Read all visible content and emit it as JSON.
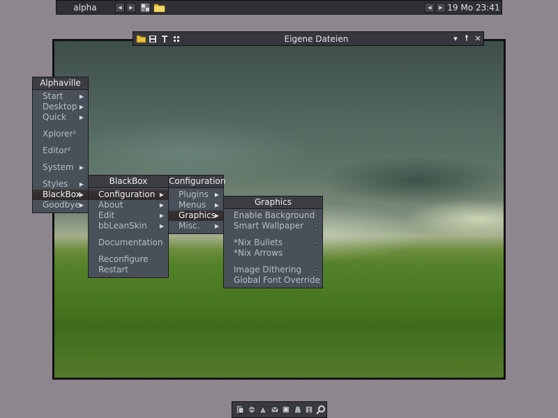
{
  "toolbar": {
    "workspace": "alpha",
    "clock": "19 Mo 23:41",
    "icons": [
      "terminal-icon",
      "folder-icon"
    ]
  },
  "explorer": {
    "title": "Eigene Dateien",
    "icons": [
      "folder-open-icon",
      "save-icon",
      "text-icon",
      "grid-icon"
    ],
    "controls": [
      "minimize-icon",
      "maximize-icon",
      "close-icon"
    ]
  },
  "menus": {
    "alphaville": {
      "title": "Alphaville",
      "items": [
        "Start",
        "Desktop",
        "Quick",
        "Xplorer²",
        "Editor²",
        "System",
        "Styles",
        "BlackBox",
        "Goodbye"
      ]
    },
    "blackbox": {
      "title": "BlackBox",
      "items": [
        "Configuration",
        "About",
        "Edit",
        "bbLeanSkin",
        "Documentation",
        "Reconfigure",
        "Restart"
      ]
    },
    "configuration": {
      "title": "Configuration",
      "items": [
        "Plugins",
        "Menus",
        "Graphics",
        "Misc."
      ]
    },
    "graphics": {
      "title": "Graphics",
      "items": [
        "Enable Background",
        "Smart Wallpaper",
        "*Nix Bullets",
        "*Nix Arrows",
        "Image Dithering",
        "Global Font Override"
      ]
    }
  },
  "slit": {
    "icons": [
      "app-1-icon",
      "app-2-icon",
      "app-3-icon",
      "app-4-icon",
      "app-5-icon",
      "app-6-icon",
      "app-7-icon",
      "search-icon"
    ]
  },
  "colors": {
    "menu_bg": "#4a5059",
    "menu_title_bg": "#3b3d43",
    "menu_active": "#2e2a29",
    "desktop_bg": "#8e868e"
  }
}
